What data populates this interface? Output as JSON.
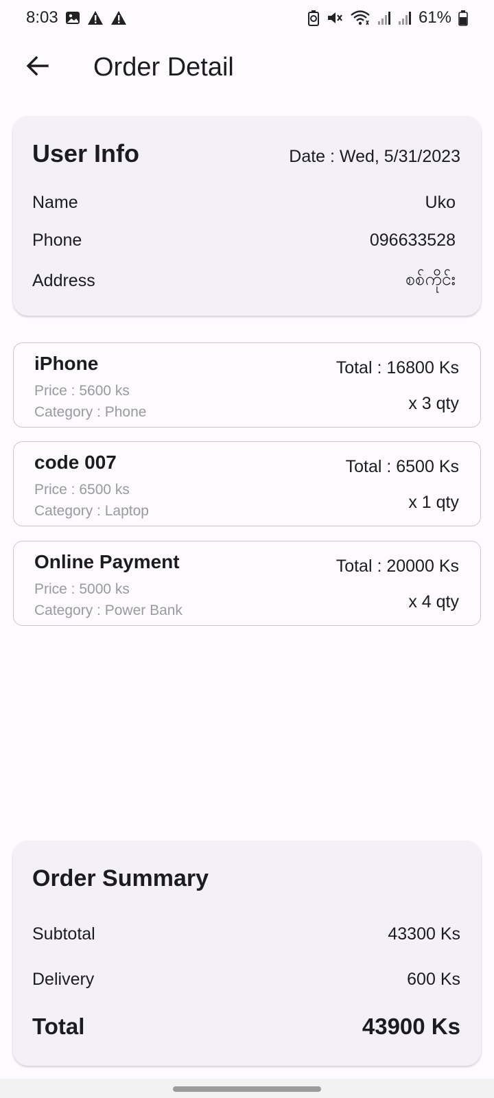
{
  "status_bar": {
    "time": "8:03",
    "battery": "61%",
    "icons_left": [
      "image-icon",
      "warning-icon",
      "warning-icon"
    ],
    "icons_right": [
      "battery-saver-icon",
      "mute-icon",
      "wifi-icon",
      "signal-icon",
      "signal-icon",
      "battery-icon"
    ]
  },
  "app_bar": {
    "title": "Order Detail",
    "back_icon": "arrow-left-icon"
  },
  "user_info": {
    "title": "User Info",
    "date": "Date : Wed, 5/31/2023",
    "rows": [
      {
        "label": "Name",
        "value": "Uko"
      },
      {
        "label": "Phone",
        "value": "096633528"
      },
      {
        "label": "Address",
        "value": "စစ်ကိုင်း"
      }
    ]
  },
  "items": [
    {
      "name": "iPhone",
      "price": "Price : 5600 ks",
      "category": "Category : Phone",
      "total": "Total : 16800 Ks",
      "qty": "x 3 qty"
    },
    {
      "name": "code 007",
      "price": "Price : 6500 ks",
      "category": "Category : Laptop",
      "total": "Total : 6500 Ks",
      "qty": "x 1 qty"
    },
    {
      "name": "Online Payment",
      "price": "Price : 5000 ks",
      "category": "Category : Power Bank",
      "total": "Total : 20000 Ks",
      "qty": "x 4 qty"
    }
  ],
  "summary": {
    "title": "Order Summary",
    "subtotal_label": "Subtotal",
    "subtotal_value": "43300 Ks",
    "delivery_label": "Delivery",
    "delivery_value": "600 Ks",
    "total_label": "Total",
    "total_value": "43900 Ks"
  },
  "colors": {
    "background": "#fdfbff",
    "card": "#f3f1f7",
    "text": "#1c1b1f",
    "secondary_text": "#9a999d",
    "border": "#c9c7cc"
  }
}
